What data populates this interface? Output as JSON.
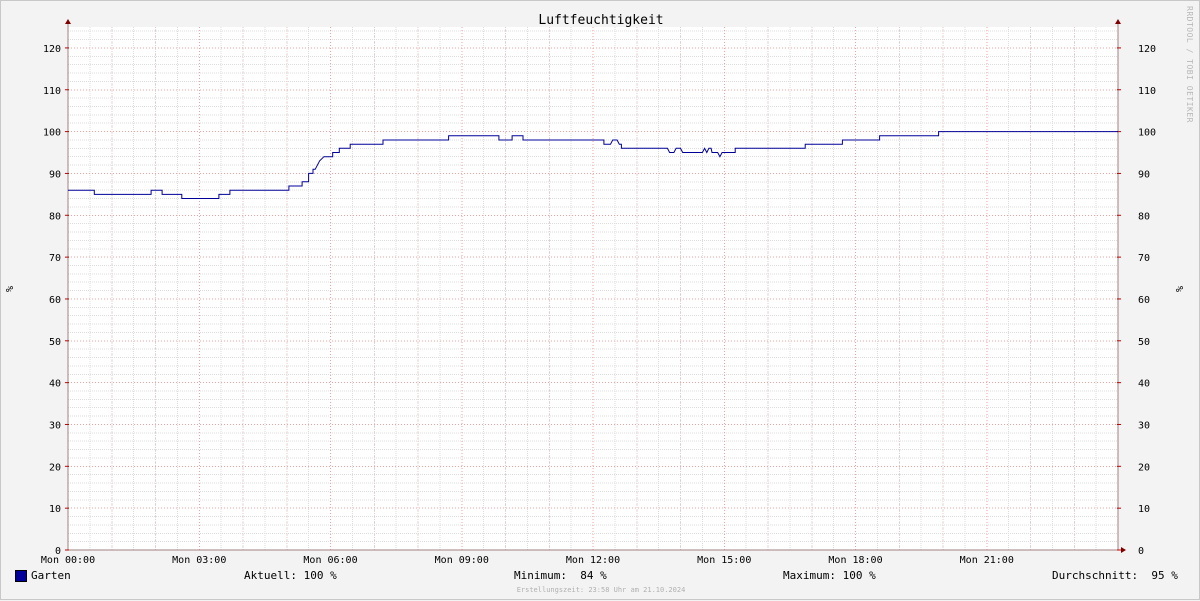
{
  "chart_data": {
    "type": "line",
    "title": "Luftfeuchtigkeit",
    "ylabel_left": "%",
    "ylabel_right": "%",
    "ylim": [
      0,
      125
    ],
    "yticks": [
      0,
      10,
      20,
      30,
      40,
      50,
      60,
      70,
      80,
      90,
      100,
      110,
      120
    ],
    "xlim_hours": [
      0,
      24
    ],
    "x_unit": "hours",
    "xticks": [
      {
        "h": 0,
        "label": "Mon 00:00"
      },
      {
        "h": 3,
        "label": "Mon 03:00"
      },
      {
        "h": 6,
        "label": "Mon 06:00"
      },
      {
        "h": 9,
        "label": "Mon 09:00"
      },
      {
        "h": 12,
        "label": "Mon 12:00"
      },
      {
        "h": 15,
        "label": "Mon 15:00"
      },
      {
        "h": 18,
        "label": "Mon 18:00"
      },
      {
        "h": 21,
        "label": "Mon 21:00"
      }
    ],
    "grid": true,
    "series": [
      {
        "name": "Garten",
        "color": "#000099",
        "points": [
          [
            0.0,
            86
          ],
          [
            0.6,
            86
          ],
          [
            0.6,
            85
          ],
          [
            1.9,
            85
          ],
          [
            1.9,
            86
          ],
          [
            2.15,
            86
          ],
          [
            2.15,
            85
          ],
          [
            2.6,
            85
          ],
          [
            2.6,
            84
          ],
          [
            3.45,
            84
          ],
          [
            3.45,
            85
          ],
          [
            3.7,
            85
          ],
          [
            3.7,
            86
          ],
          [
            5.05,
            86
          ],
          [
            5.05,
            87
          ],
          [
            5.35,
            87
          ],
          [
            5.35,
            88
          ],
          [
            5.5,
            88
          ],
          [
            5.5,
            90
          ],
          [
            5.6,
            90
          ],
          [
            5.6,
            91
          ],
          [
            5.65,
            91
          ],
          [
            5.75,
            93
          ],
          [
            5.85,
            94
          ],
          [
            6.05,
            94
          ],
          [
            6.05,
            95
          ],
          [
            6.2,
            95
          ],
          [
            6.2,
            96
          ],
          [
            6.45,
            96
          ],
          [
            6.45,
            97
          ],
          [
            7.2,
            97
          ],
          [
            7.2,
            98
          ],
          [
            8.7,
            98
          ],
          [
            8.7,
            99
          ],
          [
            9.85,
            99
          ],
          [
            9.85,
            98
          ],
          [
            10.15,
            98
          ],
          [
            10.15,
            99
          ],
          [
            10.4,
            99
          ],
          [
            10.4,
            98
          ],
          [
            12.25,
            98
          ],
          [
            12.25,
            97
          ],
          [
            12.4,
            97
          ],
          [
            12.45,
            98
          ],
          [
            12.55,
            98
          ],
          [
            12.6,
            97
          ],
          [
            12.65,
            97
          ],
          [
            12.65,
            96
          ],
          [
            13.7,
            96
          ],
          [
            13.75,
            95
          ],
          [
            13.85,
            95
          ],
          [
            13.9,
            96
          ],
          [
            14.0,
            96
          ],
          [
            14.05,
            95
          ],
          [
            14.5,
            95
          ],
          [
            14.55,
            96
          ],
          [
            14.6,
            95
          ],
          [
            14.65,
            96
          ],
          [
            14.7,
            96
          ],
          [
            14.72,
            95
          ],
          [
            14.85,
            95
          ],
          [
            14.9,
            94
          ],
          [
            14.95,
            95
          ],
          [
            15.25,
            95
          ],
          [
            15.25,
            96
          ],
          [
            16.85,
            96
          ],
          [
            16.85,
            97
          ],
          [
            17.7,
            97
          ],
          [
            17.7,
            98
          ],
          [
            18.55,
            98
          ],
          [
            18.55,
            99
          ],
          [
            19.9,
            99
          ],
          [
            19.9,
            100
          ],
          [
            24.0,
            100
          ]
        ]
      }
    ],
    "legend": {
      "series_name": "Garten",
      "current": "Aktuell: 100 %",
      "minimum": "Minimum:  84 %",
      "maximum": "Maximum: 100 %",
      "average": "Durchschnitt:  95 %"
    },
    "footer": "Erstellungszeit: 23:58 Uhr am 21.10.2024",
    "watermark": "RRDTOOL / TOBI OETIKER"
  },
  "colors": {
    "background": "#f3f3f3",
    "canvas": "#ffffff",
    "major_grid": "#f0a0a0",
    "minor_grid": "#dddddd",
    "axis": "#a08080",
    "arrow": "#800000",
    "line": "#000099"
  }
}
